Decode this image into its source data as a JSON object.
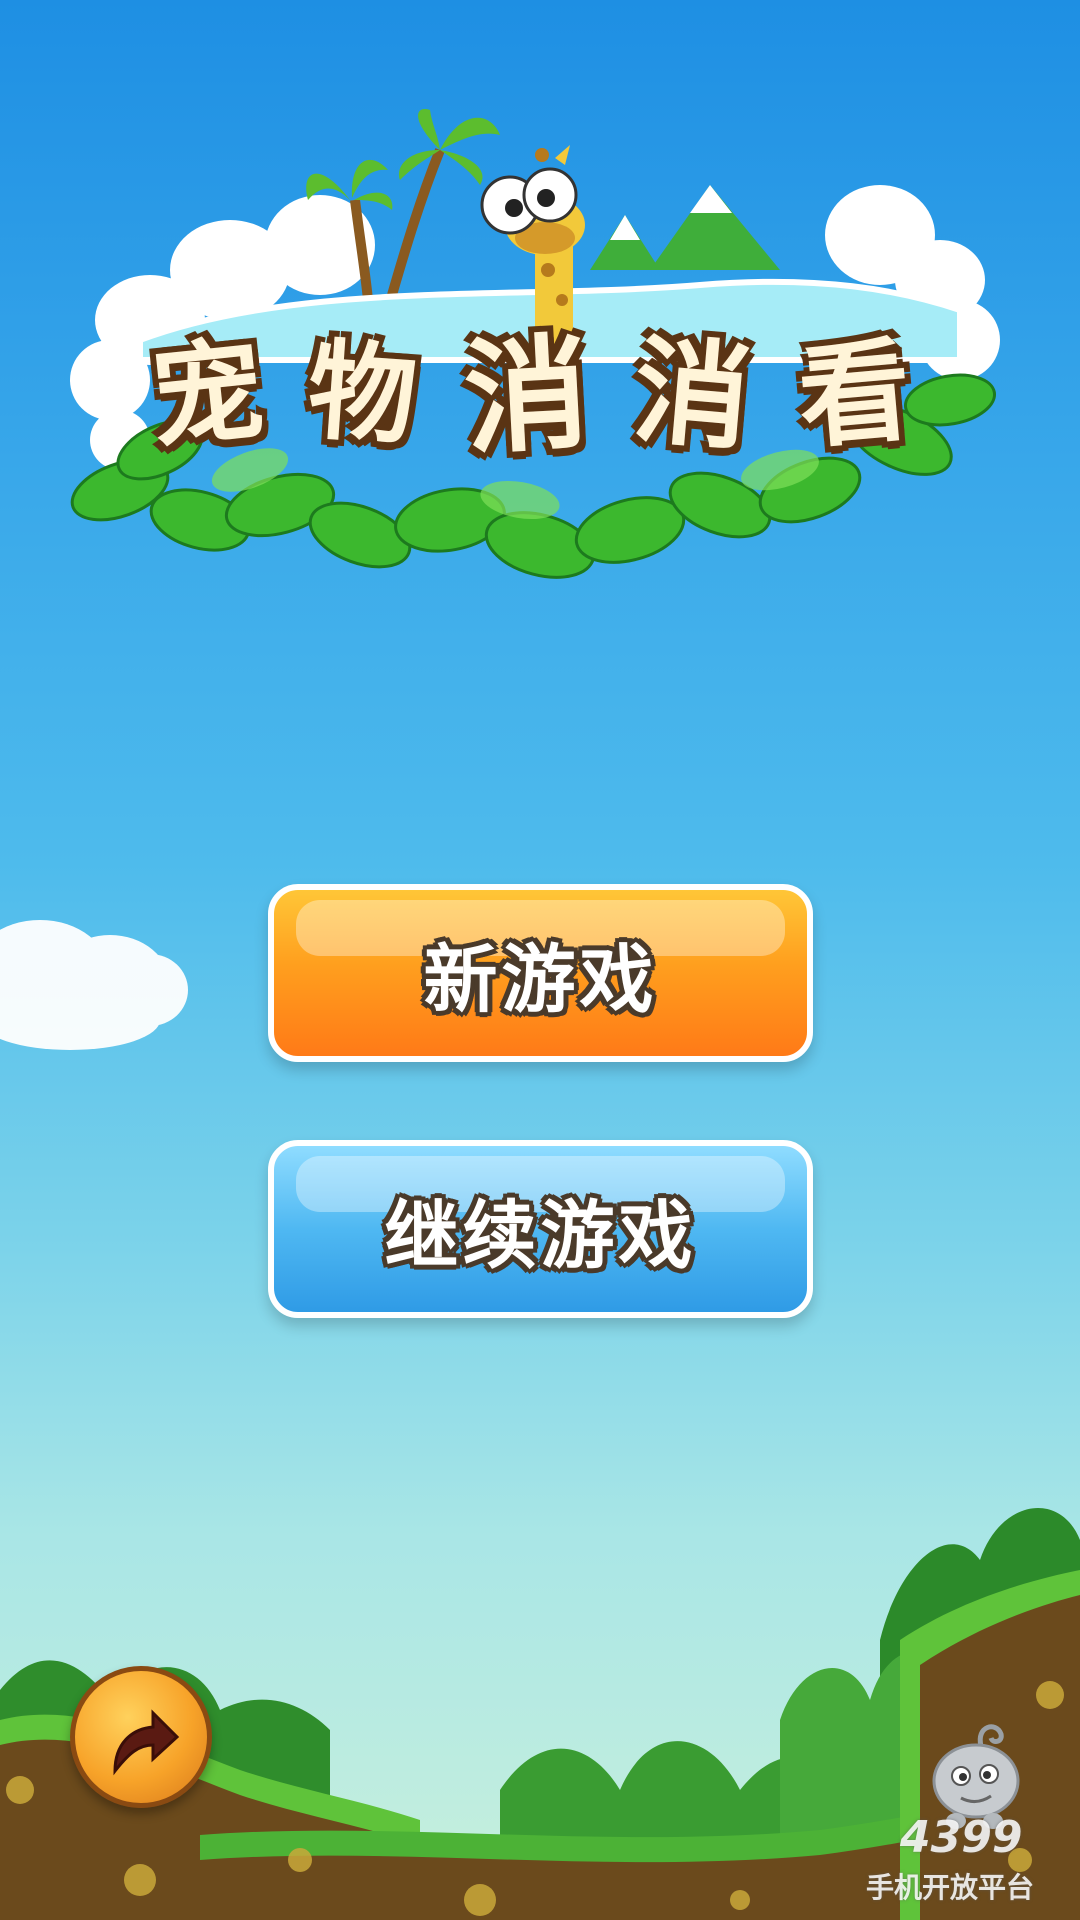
{
  "title": {
    "chars": [
      "宠",
      "物",
      "消",
      "消",
      "看"
    ]
  },
  "buttons": {
    "new_game": "新游戏",
    "continue_game": "继续游戏"
  },
  "watermark": {
    "number": "4399",
    "subtitle": "手机开放平台"
  },
  "colors": {
    "sky_top": "#1e8fe3",
    "new_game_button": "#ff9f1e",
    "continue_button": "#4fb8f2",
    "leaf_green": "#3cb82e",
    "soil_brown": "#6b4a1c"
  },
  "icons": {
    "share": "share-arrow-icon",
    "mascot": "giraffe-mascot",
    "watermark_mascot": "gray-mascot"
  }
}
